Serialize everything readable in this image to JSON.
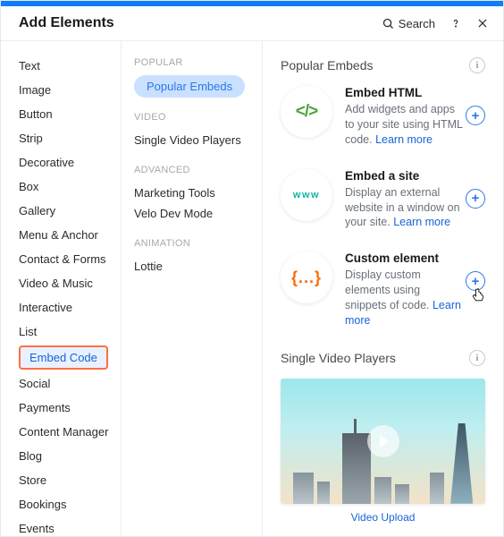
{
  "header": {
    "title": "Add Elements",
    "search_label": "Search"
  },
  "sidebar": {
    "items": [
      "Text",
      "Image",
      "Button",
      "Strip",
      "Decorative",
      "Box",
      "Gallery",
      "Menu & Anchor",
      "Contact & Forms",
      "Video & Music",
      "Interactive",
      "List",
      "Embed Code",
      "Social",
      "Payments",
      "Content Manager",
      "Blog",
      "Store",
      "Bookings",
      "Events"
    ],
    "selected_index": 12
  },
  "submenu": {
    "groups": [
      {
        "label": "POPULAR",
        "items": [
          "Popular Embeds"
        ],
        "active_index": 0
      },
      {
        "label": "VIDEO",
        "items": [
          "Single Video Players"
        ]
      },
      {
        "label": "ADVANCED",
        "items": [
          "Marketing Tools",
          "Velo Dev Mode"
        ]
      },
      {
        "label": "ANIMATION",
        "items": [
          "Lottie"
        ]
      }
    ]
  },
  "main": {
    "popular_title": "Popular Embeds",
    "embeds": [
      {
        "icon": "html",
        "icon_text": "</>",
        "title": "Embed HTML",
        "desc": "Add widgets and apps to your site using HTML code.",
        "learn": "Learn more",
        "cursor": false
      },
      {
        "icon": "www",
        "icon_text": "www",
        "title": "Embed a site",
        "desc": "Display an external website in a window on your site.",
        "learn": "Learn more",
        "cursor": false
      },
      {
        "icon": "curly",
        "icon_text": "{...}",
        "title": "Custom element",
        "desc": "Display custom elements using snippets of code.",
        "learn": "Learn more",
        "cursor": true
      }
    ],
    "video_section_title": "Single Video Players",
    "video_caption": "Video Upload"
  }
}
